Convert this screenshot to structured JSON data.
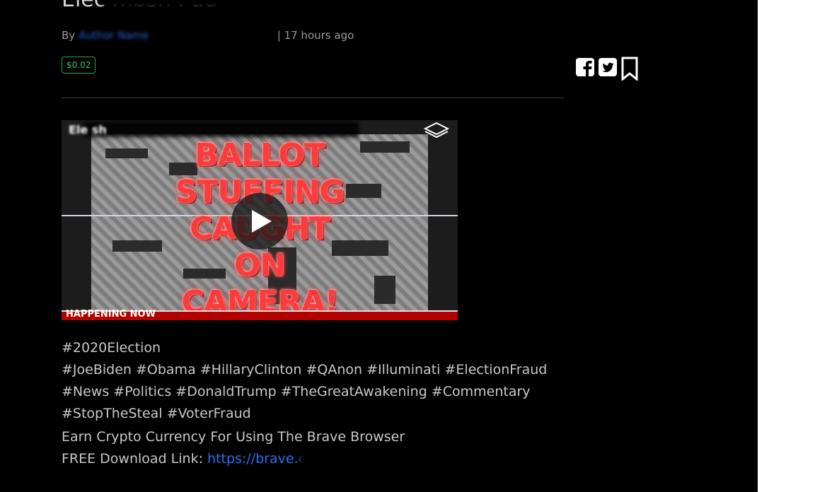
{
  "post": {
    "title_fragment": "Elec            mbsh        l       ud",
    "byline_prefix": "By",
    "author": "Author Name",
    "byline_separator": "|",
    "posted_ago": "17 hours ago",
    "price": "$0.02"
  },
  "share": {
    "icons": [
      "facebook-icon",
      "twitter-icon",
      "bookmark-icon"
    ]
  },
  "video": {
    "title": "Ele             sh",
    "overlay_text": "BALLOT\nSTUFFING\nCAUGHT\nON\nCAMERA!",
    "banner_text": "HAPPENING NOW"
  },
  "hashtags": {
    "line1": "#2020Election",
    "line2": "#JoeBiden #Obama #HillaryClinton #QAnon #Illuminati #ElectionFraud",
    "line3": "#News #Politics #DonaldTrump #TheGreatAwakening #Commentary",
    "line4": "#StopTheSteal #VoterFraud"
  },
  "promo": {
    "crypto_line": "Earn Crypto Currency For Using The Brave Browser",
    "download_prefix": "FREE Download Link:",
    "download_link": "https://brave.c"
  },
  "colors": {
    "background": "#000000",
    "text": "#c8c8c8",
    "link": "#2a6ff0",
    "price": "#3fbf5f"
  }
}
